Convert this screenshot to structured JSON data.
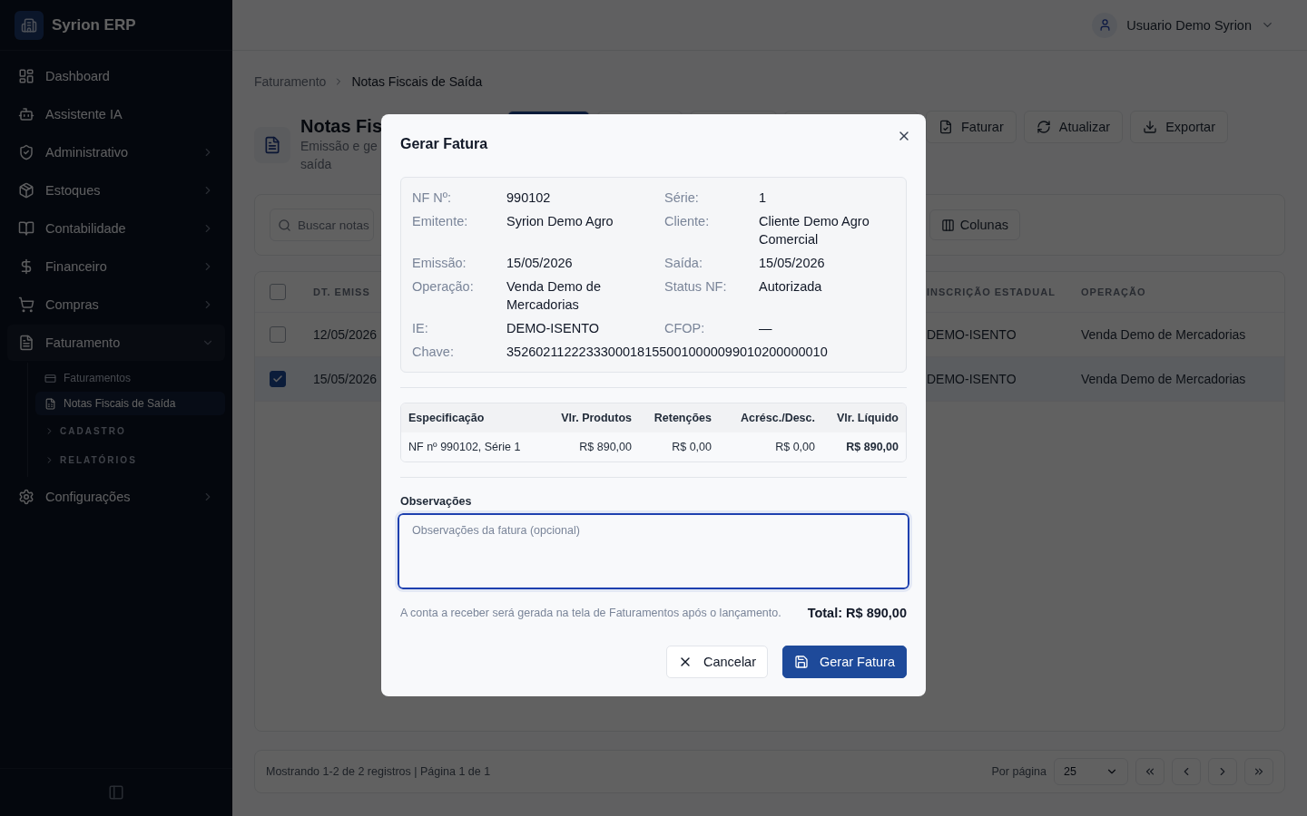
{
  "sidebar": {
    "brand": "Syrion ERP",
    "items": [
      {
        "label": "Dashboard",
        "has_children": false,
        "expanded": false
      },
      {
        "label": "Assistente IA",
        "has_children": false,
        "expanded": false
      },
      {
        "label": "Administrativo",
        "has_children": true,
        "expanded": false
      },
      {
        "label": "Estoques",
        "has_children": true,
        "expanded": false
      },
      {
        "label": "Contabilidade",
        "has_children": true,
        "expanded": false
      },
      {
        "label": "Financeiro",
        "has_children": true,
        "expanded": false
      },
      {
        "label": "Compras",
        "has_children": true,
        "expanded": false
      },
      {
        "label": "Faturamento",
        "has_children": true,
        "expanded": true,
        "children": [
          {
            "label": "Faturamentos",
            "selected": false
          },
          {
            "label": "Notas Fiscais de Saída",
            "selected": true
          }
        ],
        "sections": [
          "CADASTRO",
          "RELATÓRIOS"
        ]
      },
      {
        "label": "Configurações",
        "has_children": true,
        "expanded": false
      }
    ]
  },
  "topbar": {
    "user": "Usuario Demo Syrion"
  },
  "breadcrumb": [
    "Faturamento",
    "Notas Fiscais de Saída"
  ],
  "page_header": {
    "title": "Notas Fis",
    "subtitle_lines": [
      "Emissão e ge",
      "saída"
    ]
  },
  "toolbar": [
    "Faturar",
    "Atualizar",
    "Exportar"
  ],
  "filters": {
    "search_placeholder": "Buscar notas",
    "columns_button": "Colunas"
  },
  "table": {
    "all_checked": false,
    "columns": [
      "DT. EMISS",
      "INSCRIÇÃO ESTADUAL",
      "OPERAÇÃO"
    ],
    "rows": [
      {
        "checked": false,
        "cells": [
          "12/05/2026",
          "DEMO-ISENTO",
          "Venda Demo de Mercadorias"
        ]
      },
      {
        "checked": true,
        "cells": [
          "15/05/2026",
          "DEMO-ISENTO",
          "Venda Demo de Mercadorias"
        ]
      }
    ]
  },
  "footer": {
    "summary": "Mostrando 1-2 de 2 registros | Página 1 de 1",
    "per_page_label": "Por página",
    "per_page": "25"
  },
  "dialog": {
    "title": "Gerar Fatura",
    "details": [
      {
        "label": "NF Nº:",
        "value": "990102"
      },
      {
        "label": "Série:",
        "value": "1"
      },
      {
        "label": "Emitente:",
        "value": "Syrion Demo Agro"
      },
      {
        "label": "Cliente:",
        "value": "Cliente Demo Agro Comercial"
      },
      {
        "label": "Emissão:",
        "value": "15/05/2026"
      },
      {
        "label": "Saída:",
        "value": "15/05/2026"
      },
      {
        "label": "Operação:",
        "value": "Venda Demo de Mercadorias"
      },
      {
        "label": "Status NF:",
        "value": "Autorizada"
      },
      {
        "label": "IE:",
        "value": "DEMO-ISENTO"
      },
      {
        "label": "CFOP:",
        "value": "—"
      }
    ],
    "key": {
      "label": "Chave:",
      "value": "35260211222333000181550010000099010200000010"
    },
    "summary_table": {
      "columns": [
        "Especificação",
        "Vlr. Produtos",
        "Retenções",
        "Acrésc./Desc.",
        "Vlr. Líquido"
      ],
      "row": [
        "NF nº 990102, Série 1",
        "R$ 890,00",
        "R$ 0,00",
        "R$ 0,00",
        "R$ 890,00"
      ]
    },
    "notes_label": "Observações",
    "notes_placeholder": "Observações da fatura (opcional)",
    "hint": "A conta a receber será gerada na tela de Faturamentos após o lançamento.",
    "total": "Total: R$ 890,00",
    "buttons": [
      "Cancelar",
      "Gerar Fatura"
    ]
  }
}
